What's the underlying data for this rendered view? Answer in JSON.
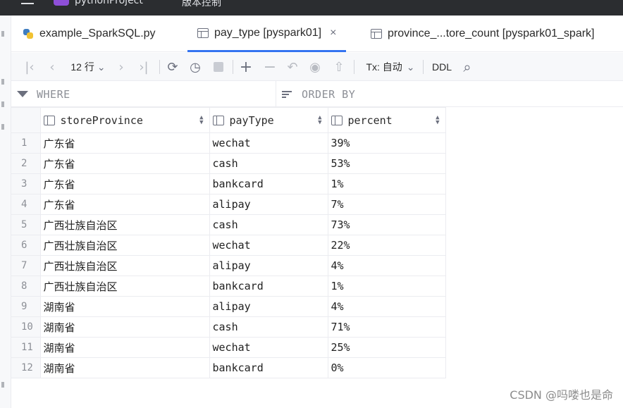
{
  "titlebar": {
    "project": "pythonProject",
    "vcs": "版本控制"
  },
  "tabs": [
    {
      "label": "example_SparkSQL.py"
    },
    {
      "label": "pay_type [pyspark01]",
      "close": "×"
    },
    {
      "label": "province_...tore_count [pyspark01_spark]"
    }
  ],
  "toolbar": {
    "nav_first": "|‹",
    "nav_prev": "‹",
    "rows_label": "12 行",
    "rows_chevron": "⌄",
    "nav_next": "›",
    "nav_last": "›|",
    "reload": "⟳",
    "history": "◷",
    "add": "+",
    "remove": "−",
    "revert": "↶",
    "preview": "◉",
    "submit": "⇧",
    "tx_label": "Tx: 自动",
    "tx_chevron": "⌄",
    "ddl": "DDL",
    "search": "⌕"
  },
  "filter": {
    "where": "WHERE",
    "order_by": "ORDER BY"
  },
  "table": {
    "columns": [
      "storeProvince",
      "payType",
      "percent"
    ],
    "sort_up": "▲",
    "sort_down": "▼",
    "rows": [
      [
        "1",
        "广东省",
        "wechat",
        "39%"
      ],
      [
        "2",
        "广东省",
        "cash",
        "53%"
      ],
      [
        "3",
        "广东省",
        "bankcard",
        "1%"
      ],
      [
        "4",
        "广东省",
        "alipay",
        "7%"
      ],
      [
        "5",
        "广西壮族自治区",
        "cash",
        "73%"
      ],
      [
        "6",
        "广西壮族自治区",
        "wechat",
        "22%"
      ],
      [
        "7",
        "广西壮族自治区",
        "alipay",
        "4%"
      ],
      [
        "8",
        "广西壮族自治区",
        "bankcard",
        "1%"
      ],
      [
        "9",
        "湖南省",
        "alipay",
        "4%"
      ],
      [
        "10",
        "湖南省",
        "cash",
        "71%"
      ],
      [
        "11",
        "湖南省",
        "wechat",
        "25%"
      ],
      [
        "12",
        "湖南省",
        "bankcard",
        "0%"
      ]
    ]
  },
  "watermark": "CSDN @吗喽也是命",
  "colors": {
    "accent": "#3574f0",
    "titlebar": "#2b2d30",
    "toolbar_bg": "#f7f8fa",
    "grid_line": "#ebecf0"
  }
}
